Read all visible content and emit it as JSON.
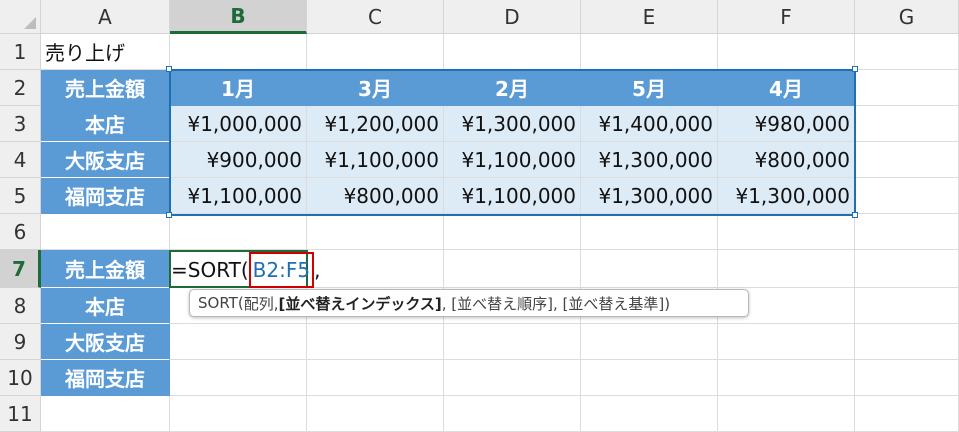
{
  "columns": [
    "A",
    "B",
    "C",
    "D",
    "E",
    "F",
    "G"
  ],
  "rows": [
    "1",
    "2",
    "3",
    "4",
    "5",
    "6",
    "7",
    "8",
    "9",
    "10",
    "11"
  ],
  "a1_title": "売り上げ",
  "table_header": {
    "corner": "売上金額",
    "months": [
      "1月",
      "3月",
      "2月",
      "5月",
      "4月"
    ]
  },
  "table_rows": [
    {
      "label": "本店",
      "values": [
        "¥1,000,000",
        "¥1,200,000",
        "¥1,300,000",
        "¥1,400,000",
        "¥980,000"
      ]
    },
    {
      "label": "大阪支店",
      "values": [
        "¥900,000",
        "¥1,100,000",
        "¥1,100,000",
        "¥1,300,000",
        "¥800,000"
      ]
    },
    {
      "label": "福岡支店",
      "values": [
        "¥1,100,000",
        "¥800,000",
        "¥1,100,000",
        "¥1,300,000",
        "¥1,300,000"
      ]
    }
  ],
  "second_table": {
    "header": "売上金額",
    "labels": [
      "本店",
      "大阪支店",
      "福岡支店"
    ]
  },
  "formula": {
    "prefix": "=SORT(",
    "ref": "B2:F5",
    "suffix": ","
  },
  "tooltip": {
    "func": "SORT(",
    "arg1": "配列, ",
    "arg2": "[並べ替えインデックス]",
    "rest": ", [並べ替え順序], [並べ替え基準])"
  },
  "colors": {
    "header_blue": "#5b9bd5",
    "light_blue": "#ddebf7",
    "selection_blue": "#1f6fb5",
    "active_green": "#1e6a39",
    "ref_red": "#d00000"
  }
}
